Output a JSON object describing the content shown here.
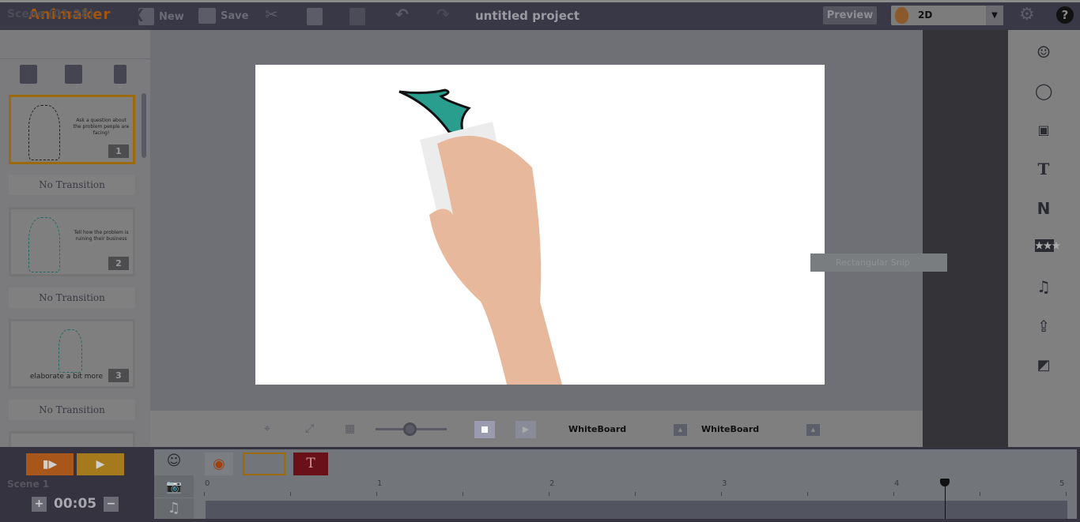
{
  "app": {
    "logo": "Animaker",
    "project_title": "untitled project"
  },
  "toolbar": {
    "new": "New",
    "save": "Save",
    "preview": "Preview",
    "mode": "2D"
  },
  "scenes_panel": {
    "header": "Scene  (01:28)",
    "scenes": [
      {
        "number": "1",
        "text": "Ask a question about the problem people are facing!",
        "selected": true
      },
      {
        "number": "2",
        "text": "Tell how the problem is ruining their business",
        "selected": false
      },
      {
        "number": "3",
        "text": "elaborate a bit more",
        "selected": false
      }
    ],
    "transitions": [
      "No Transition",
      "No Transition",
      "No Transition"
    ]
  },
  "right_tools": [
    "character-icon",
    "bulb-icon",
    "image-icon",
    "text-icon",
    "n-icon",
    "rating-icon",
    "music-icon",
    "upload-icon",
    "background-icon"
  ],
  "overlay": {
    "snip_label": "Rectangular Snip"
  },
  "controls": {
    "bg_label_1": "WhiteBoard",
    "bg_label_2": "WhiteBoard",
    "zoom_level": 0.5
  },
  "timeline": {
    "scene_label": "Scene 1",
    "duration": "00:05",
    "ruler": [
      "0",
      "1",
      "2",
      "3",
      "4",
      "5"
    ],
    "playhead_seconds": 4.3,
    "text_layer": "T"
  },
  "colors": {
    "topbar": "#393847",
    "accent_orange": "#a9561a",
    "accent_yellow": "#a47a1c",
    "selected_border": "#9b6a0c"
  }
}
